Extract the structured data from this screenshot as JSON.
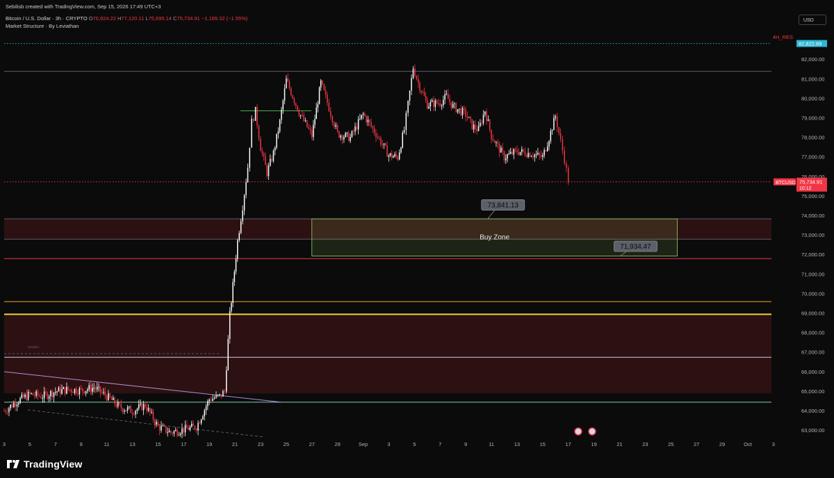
{
  "header": {
    "credit": "Sebilisb created with TradingView.com, Sep 15, 2026 17:49 UTC+3",
    "symbol": "Bitcoin / U.S. Dollar · 3h · CRYPTO",
    "open_k": "O",
    "open": "76,924.22",
    "high_k": "H",
    "high": "77,120.11",
    "low_k": "L",
    "low": "75,695.14",
    "close_k": "C",
    "close": "75,734.91",
    "change": "−1,189.32 (−1.55%)",
    "indicator": "Market Structure · By Leviathan"
  },
  "currency_button": "USD",
  "brand": "TradingView",
  "colors": {
    "background": "#0b0b0b",
    "up": "#ffffff",
    "down": "#f23645",
    "price_tag": "#f23645",
    "res_tag": "#2bb7d6",
    "buy_zone": "#9bd066",
    "demand_zone": "#3a1416"
  },
  "chart_data": {
    "type": "candlestick",
    "title": "",
    "y_axis": {
      "min": 62700,
      "max": 83200,
      "ticks": [
        "64,000.00",
        "65,000.00",
        "66,000.00",
        "67,000.00",
        "68,000.00",
        "69,000.00",
        "70,000.00",
        "71,000.00",
        "72,000.00",
        "73,000.00",
        "74,000.00",
        "75,000.00",
        "76,000.00",
        "77,000.00",
        "78,000.00",
        "79,000.00",
        "80,000.00",
        "81,000.00",
        "82,000.00",
        "63,000.00"
      ],
      "tick_values": [
        64000,
        65000,
        66000,
        67000,
        68000,
        69000,
        70000,
        71000,
        72000,
        73000,
        74000,
        75000,
        76000,
        77000,
        78000,
        79000,
        80000,
        81000,
        82000,
        63000
      ]
    },
    "x_axis": {
      "labels": [
        "3",
        "5",
        "7",
        "9",
        "11",
        "13",
        "15",
        "17",
        "19",
        "21",
        "23",
        "25",
        "27",
        "29",
        "Sep",
        "3",
        "5",
        "7",
        "9",
        "11",
        "13",
        "15",
        "17",
        "19",
        "21",
        "23",
        "25",
        "27",
        "29",
        "Oct",
        "3"
      ],
      "label_days": [
        0,
        2,
        4,
        6,
        8,
        10,
        12,
        14,
        16,
        18,
        20,
        22,
        24,
        26,
        28,
        30,
        32,
        34,
        36,
        38,
        40,
        42,
        44,
        46,
        48,
        50,
        52,
        54,
        56,
        58,
        60
      ],
      "start": "Aug 3",
      "visible_days": [
        0,
        61.2
      ]
    },
    "series_waypoints": [
      [
        0,
        64000
      ],
      [
        1.0,
        64500
      ],
      [
        2.0,
        64850
      ],
      [
        3.0,
        64750
      ],
      [
        4.0,
        65000
      ],
      [
        5.0,
        65100
      ],
      [
        6.0,
        65050
      ],
      [
        7.0,
        65200
      ],
      [
        8.0,
        64750
      ],
      [
        9.0,
        64200
      ],
      [
        10.0,
        64000
      ],
      [
        11.0,
        64300
      ],
      [
        12.0,
        63200
      ],
      [
        13.0,
        62900
      ],
      [
        14.0,
        63050
      ],
      [
        15.0,
        63200
      ],
      [
        16.0,
        64600
      ],
      [
        16.8,
        64750
      ],
      [
        17.2,
        65000
      ],
      [
        17.6,
        68900
      ],
      [
        18.2,
        72700
      ],
      [
        18.6,
        74500
      ],
      [
        19.0,
        76500
      ],
      [
        19.3,
        78800
      ],
      [
        19.6,
        79350
      ],
      [
        20.0,
        77500
      ],
      [
        20.5,
        76200
      ],
      [
        21.0,
        77200
      ],
      [
        21.5,
        78800
      ],
      [
        22.0,
        80950
      ],
      [
        23.0,
        79300
      ],
      [
        24.0,
        78100
      ],
      [
        24.7,
        80800
      ],
      [
        25.2,
        79800
      ],
      [
        26.0,
        78200
      ],
      [
        27.0,
        78000
      ],
      [
        28.0,
        79200
      ],
      [
        29.0,
        78200
      ],
      [
        30.0,
        77100
      ],
      [
        30.7,
        77000
      ],
      [
        31.2,
        78400
      ],
      [
        31.5,
        79700
      ],
      [
        31.9,
        81600
      ],
      [
        32.3,
        80800
      ],
      [
        33.0,
        79700
      ],
      [
        34.0,
        79800
      ],
      [
        34.5,
        80100
      ],
      [
        35.0,
        79600
      ],
      [
        36.0,
        79200
      ],
      [
        36.5,
        78600
      ],
      [
        37.0,
        78400
      ],
      [
        37.5,
        79400
      ],
      [
        38.0,
        78100
      ],
      [
        39.0,
        77000
      ],
      [
        40.0,
        77300
      ],
      [
        41.0,
        77200
      ],
      [
        42.0,
        77000
      ],
      [
        42.5,
        78000
      ],
      [
        43.0,
        79100
      ],
      [
        43.4,
        77800
      ],
      [
        43.7,
        76900
      ],
      [
        44.0,
        75734.91
      ]
    ],
    "levels": [
      {
        "name": "4H_RES",
        "value": 82822.89,
        "style": "dotted",
        "color": "#2bb7d6"
      },
      {
        "name": "range_high",
        "value": 81400,
        "style": "solid",
        "color": "#5d606b"
      },
      {
        "name": "current_price",
        "value": 75734.91,
        "style": "dotted",
        "color": "#f23645"
      },
      {
        "name": "supply_top",
        "value": 73841.13,
        "style": "solid",
        "color": "#5d606b"
      },
      {
        "name": "supply_mid",
        "value": 72800,
        "style": "solid",
        "color": "#5d606b"
      },
      {
        "name": "support_red",
        "value": 71800,
        "style": "solid",
        "color": "#f23645"
      },
      {
        "name": "support_orange",
        "value": 69600,
        "style": "solid",
        "color": "#f5a623"
      },
      {
        "name": "support_yellow",
        "value": 68950,
        "style": "solid",
        "color": "#f0d23a"
      },
      {
        "name": "lavender",
        "value": 66750,
        "style": "solid",
        "color": "#c7c9f0"
      },
      {
        "name": "green_line",
        "value": 64450,
        "style": "solid",
        "color": "#7fd6a9"
      }
    ],
    "zones": [
      {
        "name": "supply_band",
        "from": 72800,
        "to": 73841.13
      },
      {
        "name": "demand_band",
        "from": 64900,
        "to": 68950
      }
    ],
    "buy_zone": {
      "label": "Buy Zone",
      "top": 73841.13,
      "bottom": 71934.47,
      "day_from": 24.0,
      "day_to": 52.5
    },
    "callouts": [
      {
        "text": "73,841.13",
        "value": 73841.13
      },
      {
        "text": "71,934.47",
        "value": 71934.47
      }
    ],
    "res_label": "4H_RES",
    "res_value": "82,822.89",
    "price_label": "BTCUSD",
    "price_value": "75,734.91",
    "countdown": "10:12",
    "choch_label": "CHoCH"
  }
}
